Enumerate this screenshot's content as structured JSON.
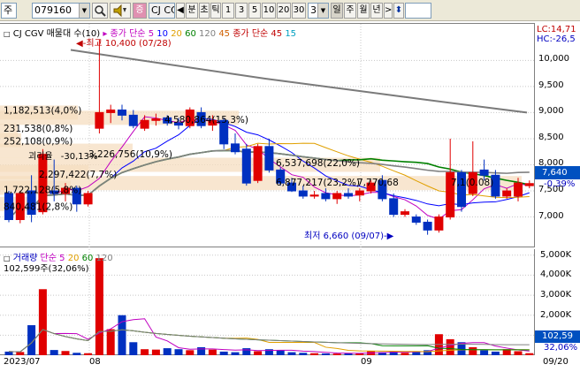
{
  "toolbar": {
    "market": "주",
    "code": "079160",
    "name": "CJ CC",
    "period_label": "분",
    "period_buttons": [
      "초",
      "틱",
      "1",
      "3",
      "5",
      "10",
      "20",
      "30"
    ],
    "interval_value": "3",
    "day_label": "일",
    "week_label": "주",
    "month_label": "월",
    "year_label": "년",
    "search_icon": "magnifier-icon",
    "sound_icon": "speaker-icon"
  },
  "price_pane": {
    "legend": {
      "title": "CJ CGV 매물대 수(10)",
      "ma_label": "종가 단순",
      "ma_periods": [
        "5",
        "10",
        "20",
        "60",
        "120",
        "45"
      ],
      "ma_colors": [
        "#c000c0",
        "#0000ff",
        "#e0a000",
        "#008000",
        "#808080",
        "#d06000"
      ],
      "bb_label": "종가 단순 45",
      "bb_period": "15",
      "bb_color": "#c00000",
      "bb_period_color": "#00a0c0"
    },
    "right_labels": {
      "lc": "LC:14,71",
      "hc": "HC:-26,5"
    },
    "annotations": {
      "high": "최고 10,400 (07/28)",
      "low": "최저 6,660 (09/07)"
    },
    "volume_profile_labels": [
      "1,182,513(4,0%)",
      "231,538(0,8%)",
      "252,108(0,9%)",
      "3,226,756(10,9%)",
      "2,297,422(7,7%)",
      "1,722,128(5,8%)",
      "840,481(2,8%)",
      "4,580,864(15,3%)",
      "6,537,698(22,0%)",
      "6,877,217(23,2%)",
      "7,770,68",
      "7,1(0.08)"
    ],
    "misc_label": "괴리율",
    "misc_value": "-30,13%",
    "axis_ticks": [
      "10,000",
      "9,500",
      "9,000",
      "8,500",
      "8,000",
      "7,500",
      "7,000"
    ],
    "current_price": "7,640",
    "current_change": "-0,39%"
  },
  "volume_pane": {
    "legend": {
      "title": "거래량",
      "ma_label": "단순",
      "periods": [
        "5",
        "20",
        "60",
        "120"
      ]
    },
    "info": "102,599주(32,06%)",
    "axis_ticks": [
      "5,000K",
      "4,000K",
      "3,000K",
      "2,000K",
      "1,000K"
    ],
    "current_volume": "102,59",
    "current_pct": "32,06%"
  },
  "time_axis": {
    "labels": [
      "2023/07",
      "08",
      "09",
      "09/20"
    ]
  },
  "chart_data": {
    "type": "candlestick",
    "y_range": [
      6400,
      10700
    ],
    "candles": [
      {
        "o": 7450,
        "h": 7500,
        "l": 6900,
        "c": 6950
      },
      {
        "o": 6950,
        "h": 7500,
        "l": 6880,
        "c": 7450
      },
      {
        "o": 7500,
        "h": 7800,
        "l": 6900,
        "c": 7050
      },
      {
        "o": 7100,
        "h": 8300,
        "l": 7050,
        "c": 8200
      },
      {
        "o": 7500,
        "h": 8100,
        "l": 7300,
        "c": 7450
      },
      {
        "o": 7450,
        "h": 7650,
        "l": 7300,
        "c": 7550
      },
      {
        "o": 7550,
        "h": 7600,
        "l": 7100,
        "c": 7250
      },
      {
        "o": 7250,
        "h": 7500,
        "l": 7200,
        "c": 7450
      },
      {
        "o": 8700,
        "h": 10400,
        "l": 8600,
        "c": 9000
      },
      {
        "o": 9000,
        "h": 9150,
        "l": 8800,
        "c": 9050
      },
      {
        "o": 9050,
        "h": 9150,
        "l": 8850,
        "c": 8950
      },
      {
        "o": 8950,
        "h": 9050,
        "l": 8700,
        "c": 8750
      },
      {
        "o": 8700,
        "h": 8950,
        "l": 8650,
        "c": 8850
      },
      {
        "o": 8850,
        "h": 8980,
        "l": 8750,
        "c": 8880
      },
      {
        "o": 8900,
        "h": 8950,
        "l": 8750,
        "c": 8800
      },
      {
        "o": 8800,
        "h": 8900,
        "l": 8680,
        "c": 8760
      },
      {
        "o": 8750,
        "h": 9100,
        "l": 8700,
        "c": 9050
      },
      {
        "o": 9000,
        "h": 9100,
        "l": 8700,
        "c": 8750
      },
      {
        "o": 8760,
        "h": 8950,
        "l": 8650,
        "c": 8850
      },
      {
        "o": 8850,
        "h": 8900,
        "l": 8300,
        "c": 8400
      },
      {
        "o": 8400,
        "h": 8600,
        "l": 8200,
        "c": 8250
      },
      {
        "o": 8300,
        "h": 8400,
        "l": 7600,
        "c": 7650
      },
      {
        "o": 7700,
        "h": 8400,
        "l": 7650,
        "c": 8350
      },
      {
        "o": 8350,
        "h": 8500,
        "l": 7850,
        "c": 7900
      },
      {
        "o": 7900,
        "h": 7950,
        "l": 7600,
        "c": 7650
      },
      {
        "o": 7650,
        "h": 7750,
        "l": 7480,
        "c": 7500
      },
      {
        "o": 7500,
        "h": 7600,
        "l": 7350,
        "c": 7400
      },
      {
        "o": 7400,
        "h": 7500,
        "l": 7350,
        "c": 7420
      },
      {
        "o": 7450,
        "h": 7550,
        "l": 7300,
        "c": 7350
      },
      {
        "o": 7350,
        "h": 7500,
        "l": 7250,
        "c": 7450
      },
      {
        "o": 7450,
        "h": 7550,
        "l": 7350,
        "c": 7400
      },
      {
        "o": 7420,
        "h": 7550,
        "l": 7300,
        "c": 7500
      },
      {
        "o": 7500,
        "h": 7700,
        "l": 7450,
        "c": 7650
      },
      {
        "o": 7700,
        "h": 7800,
        "l": 7300,
        "c": 7350
      },
      {
        "o": 7350,
        "h": 7450,
        "l": 7000,
        "c": 7050
      },
      {
        "o": 7050,
        "h": 7150,
        "l": 7000,
        "c": 7100
      },
      {
        "o": 7000,
        "h": 7050,
        "l": 6850,
        "c": 6900
      },
      {
        "o": 6900,
        "h": 6950,
        "l": 6660,
        "c": 6750
      },
      {
        "o": 6750,
        "h": 7050,
        "l": 6700,
        "c": 7000
      },
      {
        "o": 7000,
        "h": 8500,
        "l": 6950,
        "c": 7850
      },
      {
        "o": 7850,
        "h": 7900,
        "l": 7100,
        "c": 7200
      },
      {
        "o": 7450,
        "h": 8450,
        "l": 7400,
        "c": 7850
      },
      {
        "o": 7900,
        "h": 8100,
        "l": 7700,
        "c": 7800
      },
      {
        "o": 7800,
        "h": 7900,
        "l": 7350,
        "c": 7400
      },
      {
        "o": 7400,
        "h": 7550,
        "l": 7350,
        "c": 7500
      },
      {
        "o": 7400,
        "h": 7750,
        "l": 7300,
        "c": 7650
      },
      {
        "o": 7600,
        "h": 7700,
        "l": 7550,
        "c": 7640
      }
    ],
    "volumes": [
      180,
      160,
      1500,
      3300,
      260,
      210,
      120,
      100,
      4850,
      1300,
      2000,
      650,
      300,
      280,
      350,
      300,
      250,
      400,
      280,
      180,
      150,
      350,
      200,
      300,
      250,
      150,
      120,
      100,
      90,
      80,
      110,
      100,
      200,
      150,
      180,
      120,
      200,
      250,
      1050,
      800,
      650,
      400,
      250,
      180,
      300,
      200,
      102
    ],
    "volume_range": [
      0,
      5300
    ]
  }
}
